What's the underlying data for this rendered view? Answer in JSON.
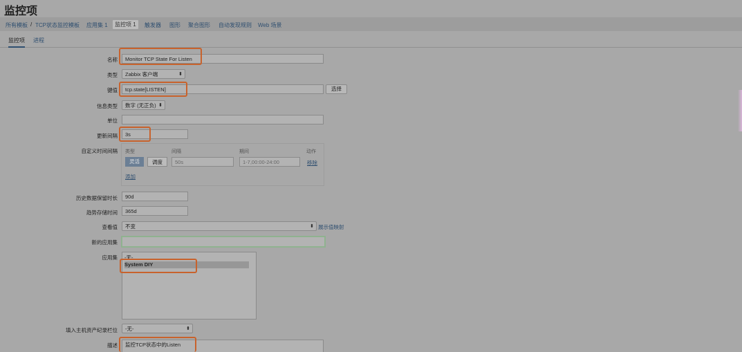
{
  "page_title": "监控项",
  "breadcrumb": {
    "root": "所有模板",
    "sep": "/",
    "template": "TCP状态监控模板",
    "items": [
      {
        "label": "应用集 1"
      },
      {
        "label": "监控项 1"
      },
      {
        "label": "触发器"
      },
      {
        "label": "图形"
      },
      {
        "label": "聚合图形"
      },
      {
        "label": "自动发现规则"
      },
      {
        "label": "Web 场景"
      }
    ]
  },
  "subtabs": [
    {
      "label": "监控项"
    },
    {
      "label": "进程"
    }
  ],
  "form": {
    "name": {
      "label": "名称",
      "value": "Monitor TCP State For Listen"
    },
    "type": {
      "label": "类型",
      "value": "Zabbix 客户端"
    },
    "key": {
      "label": "键值",
      "value": "tcp.state[LISTEN]",
      "select_button": "选择"
    },
    "info_type": {
      "label": "信息类型",
      "value": "数字 (无正负)"
    },
    "units": {
      "label": "单位",
      "value": ""
    },
    "update_interval": {
      "label": "更新间隔",
      "value": "3s"
    },
    "custom_intervals": {
      "label": "自定义时间间隔",
      "headers": {
        "type": "类型",
        "interval": "间隔",
        "period": "期间",
        "action": "动作"
      },
      "row": {
        "flexible": "灵活",
        "scheduling": "调度",
        "interval": "50s",
        "period": "1-7,00:00-24:00",
        "remove": "移除"
      },
      "add": "添加"
    },
    "history": {
      "label": "历史数据保留时长",
      "value": "90d"
    },
    "trends": {
      "label": "趋势存储时间",
      "value": "365d"
    },
    "value_map": {
      "label": "查看值",
      "value": "不变",
      "link": "展示值映射"
    },
    "new_application": {
      "label": "新的应用集",
      "value": ""
    },
    "applications": {
      "label": "应用集",
      "options": [
        "-无-",
        "System DIY"
      ]
    },
    "inventory": {
      "label": "填入主机资产纪录栏位",
      "value": "-无-"
    },
    "description": {
      "label": "描述",
      "value": "监控TCP状态中的Listen"
    }
  },
  "colors": {
    "background": "#a8a8a8",
    "highlight": "#c8622c",
    "link": "#2f4f70"
  }
}
